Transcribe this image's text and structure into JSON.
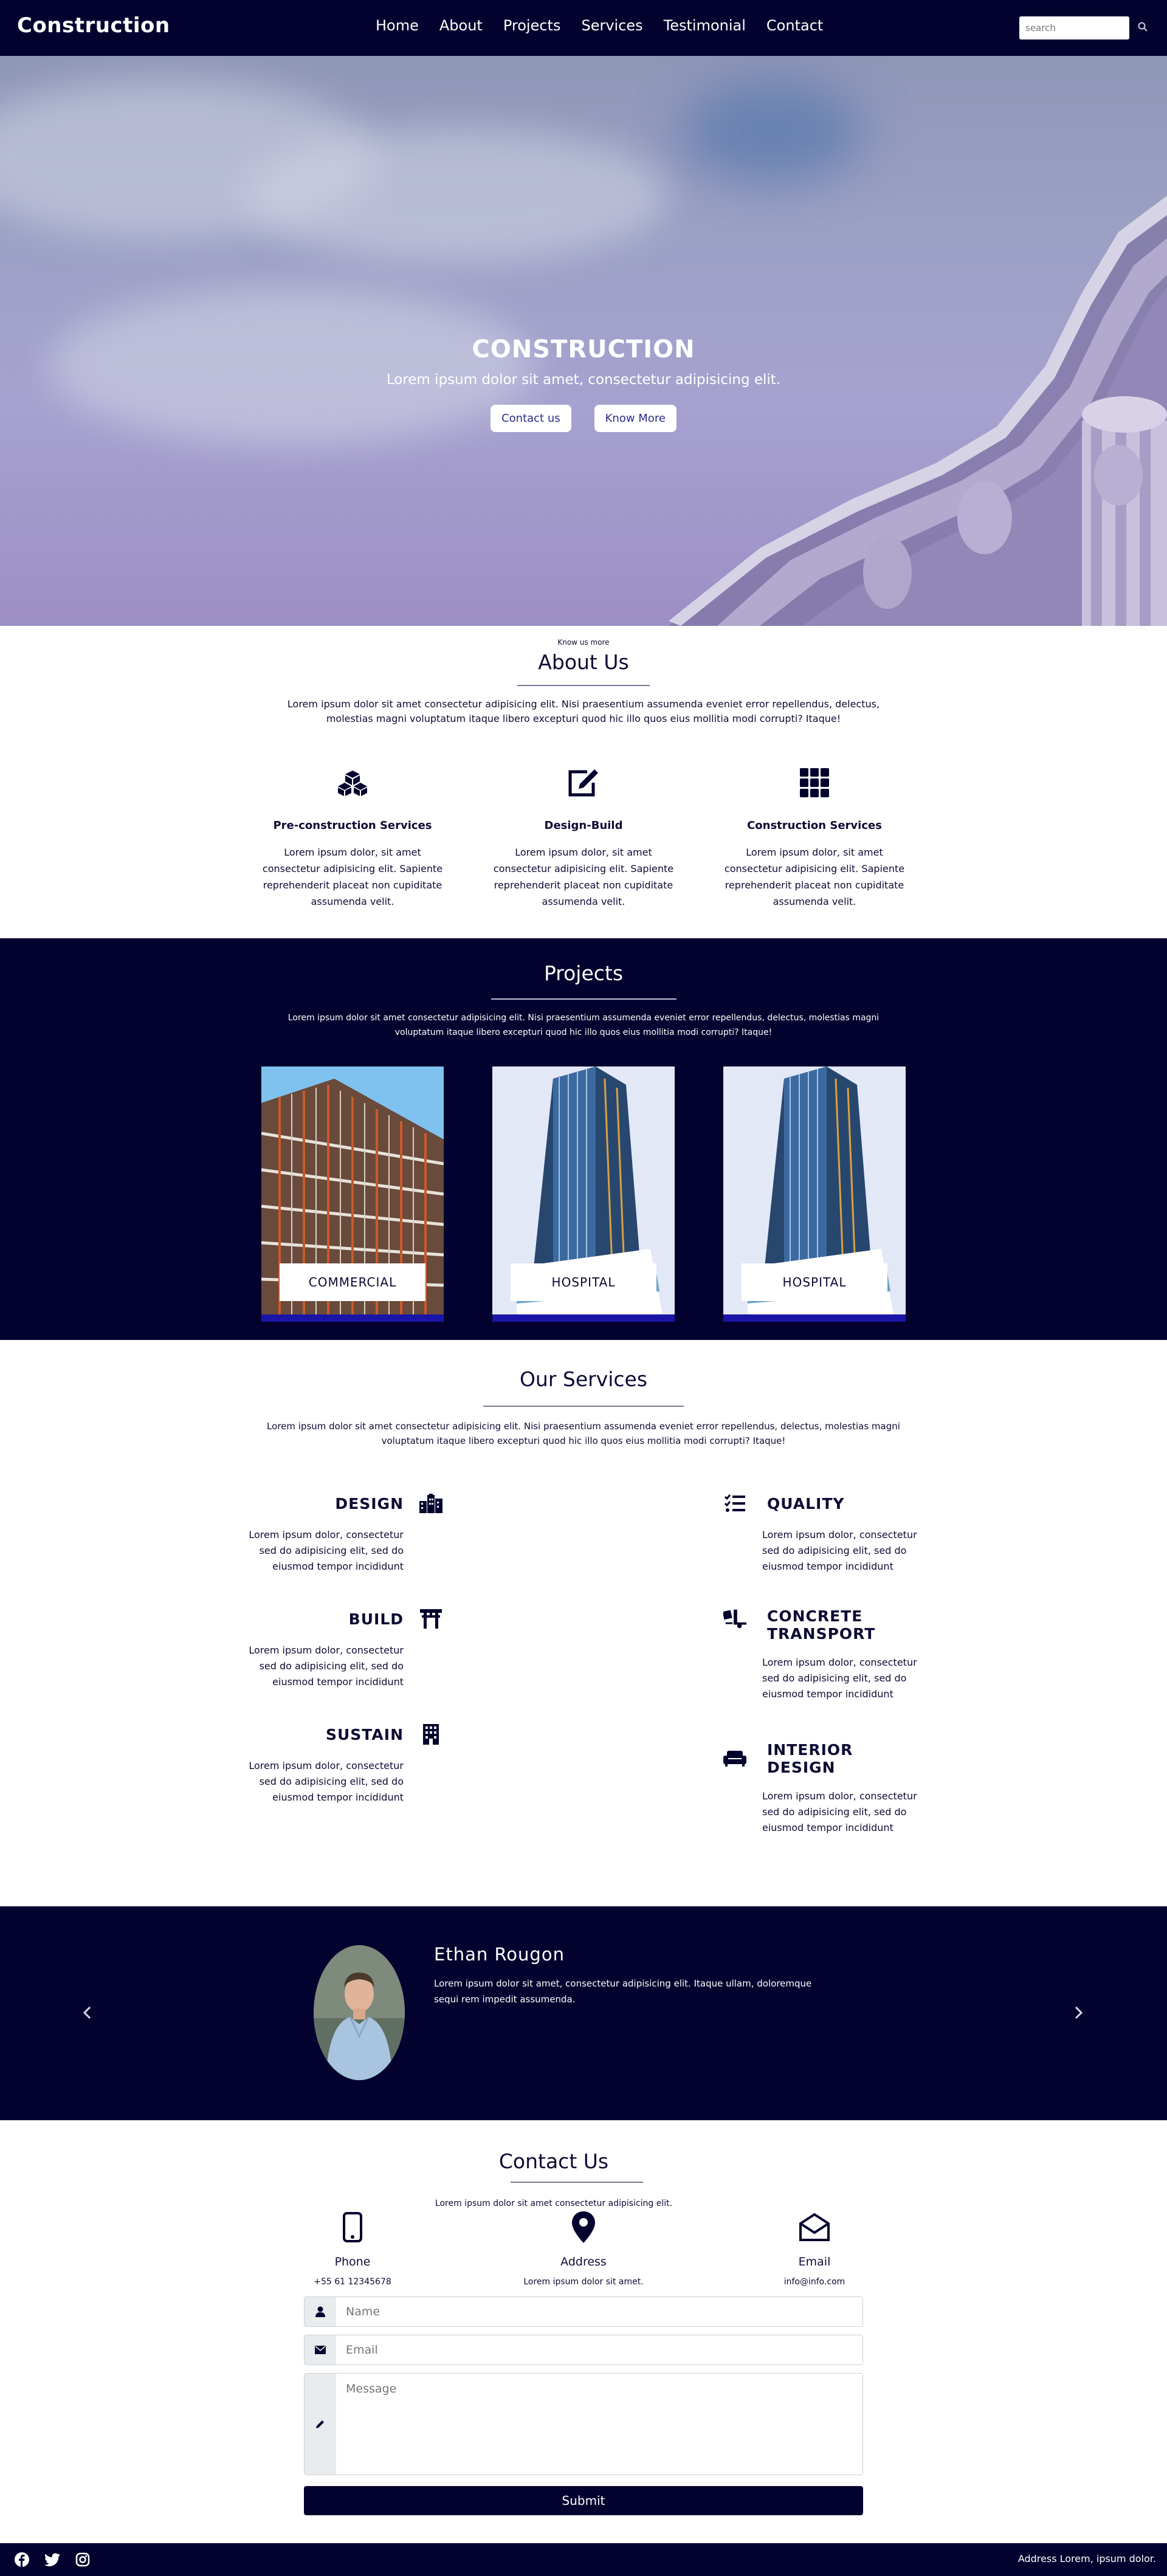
{
  "nav": {
    "brand": "Construction",
    "links": [
      "Home",
      "About",
      "Projects",
      "Services",
      "Testimonial",
      "Contact"
    ],
    "search_placeholder": "search"
  },
  "hero": {
    "title": "CONSTRUCTION",
    "subtitle": "Lorem ipsum dolor sit amet, consectetur adipisicing elit.",
    "btn_contact": "Contact us",
    "btn_more": "Know More"
  },
  "about": {
    "kicker": "Know us more",
    "title": "About Us",
    "desc": "Lorem ipsum dolor sit amet consectetur adipisicing elit. Nisi praesentium assumenda eveniet error repellendus, delectus, molestias magni voluptatum itaque libero excepturi quod hic illo quos eius mollitia modi corrupti? Itaque!",
    "features": [
      {
        "icon": "cubes-icon",
        "title": "Pre-construction Services",
        "text": "Lorem ipsum dolor, sit amet consectetur adipisicing elit. Sapiente reprehenderit placeat non cupiditate assumenda velit."
      },
      {
        "icon": "edit-icon",
        "title": "Design-Build",
        "text": "Lorem ipsum dolor, sit amet consectetur adipisicing elit. Sapiente reprehenderit placeat non cupiditate assumenda velit."
      },
      {
        "icon": "grid-icon",
        "title": "Construction Services",
        "text": "Lorem ipsum dolor, sit amet consectetur adipisicing elit. Sapiente reprehenderit placeat non cupiditate assumenda velit."
      }
    ]
  },
  "projects": {
    "title": "Projects",
    "desc": "Lorem ipsum dolor sit amet consectetur adipisicing elit. Nisi praesentium assumenda eveniet error repellendus, delectus, molestias magni voluptatum itaque libero excepturi quod hic illo quos eius mollitia modi corrupti? Itaque!",
    "cards": [
      {
        "label": "COMMERCIAL"
      },
      {
        "label": "HOSPITAL"
      },
      {
        "label": "HOSPITAL"
      }
    ]
  },
  "services": {
    "title": "Our Services",
    "desc": "Lorem ipsum dolor sit amet consectetur adipisicing elit. Nisi praesentium assumenda eveniet error repellendus, delectus, molestias magni voluptatum itaque libero excepturi quod hic illo quos eius mollitia modi corrupti? Itaque!",
    "left": [
      {
        "icon": "city-icon",
        "title": "DESIGN",
        "text": "Lorem ipsum dolor, consectetur sed do adipisicing elit, sed do eiusmod tempor incididunt"
      },
      {
        "icon": "torii-gate-icon",
        "title": "BUILD",
        "text": "Lorem ipsum dolor, consectetur sed do adipisicing elit, sed do eiusmod tempor incididunt"
      },
      {
        "icon": "building-icon",
        "title": "SUSTAIN",
        "text": "Lorem ipsum dolor, consectetur sed do adipisicing elit, sed do eiusmod tempor incididunt"
      }
    ],
    "right": [
      {
        "icon": "tasks-icon",
        "title": "QUALITY",
        "text": "Lorem ipsum dolor, consectetur sed do adipisicing elit, sed do eiusmod tempor incididunt"
      },
      {
        "icon": "truck-loading-icon",
        "title": "CONCRETE TRANSPORT",
        "text": "Lorem ipsum dolor, consectetur sed do adipisicing elit, sed do eiusmod tempor incididunt"
      },
      {
        "icon": "couch-icon",
        "title": "INTERIOR DESIGN",
        "text": "Lorem ipsum dolor, consectetur sed do adipisicing elit, sed do eiusmod tempor incididunt"
      }
    ]
  },
  "testimonial": {
    "name": "Ethan Rougon",
    "text": "Lorem ipsum dolor sit amet, consectetur adipisicing elit. Itaque ullam, doloremque sequi rem impedit assumenda."
  },
  "contact": {
    "title": "Contact Us",
    "desc": "Lorem ipsum dolor sit amet consectetur adipisicing elit.",
    "info": [
      {
        "icon": "phone-icon",
        "label": "Phone",
        "value": "+55 61 12345678"
      },
      {
        "icon": "map-marker-icon",
        "label": "Address",
        "value": "Lorem ipsum dolor sit amet."
      },
      {
        "icon": "envelope-open-icon",
        "label": "Email",
        "value": "info@info.com"
      }
    ],
    "name_placeholder": "Name",
    "email_placeholder": "Email",
    "message_placeholder": "Message",
    "submit": "Submit"
  },
  "footer": {
    "address": "Address Lorem, ipsum dolor."
  },
  "colors": {
    "navy": "#03022e",
    "accent_blue": "#1a15a8",
    "text": "#0d0b33"
  }
}
